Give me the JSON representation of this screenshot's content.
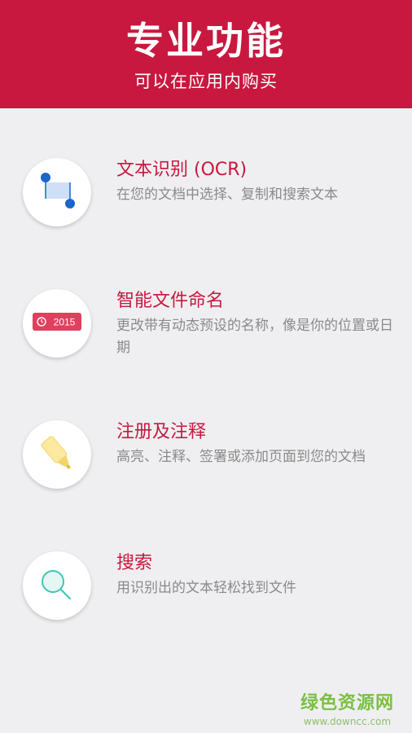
{
  "header": {
    "title": "专业功能",
    "subtitle": "可以在应用内购买"
  },
  "features": [
    {
      "title": "文本识别 (OCR)",
      "description": "在您的文档中选择、复制和搜索文本",
      "icon": "ocr-select-icon"
    },
    {
      "title": "智能文件命名",
      "description": "更改带有动态预设的名称，像是你的位置或日期",
      "icon": "date-stamp-icon",
      "badge": "2015"
    },
    {
      "title": "注册及注释",
      "description": "高亮、注释、签署或添加页面到您的文档",
      "icon": "highlighter-icon"
    },
    {
      "title": "搜索",
      "description": "用识别出的文本轻松找到文件",
      "icon": "search-icon"
    }
  ],
  "watermark": {
    "logo": "绿色资源网",
    "url": "www.downcc.com"
  },
  "colors": {
    "accent": "#c8183f",
    "background": "#efeff1",
    "description_text": "#8a8a8a",
    "icon_blue": "#1a66c9"
  }
}
